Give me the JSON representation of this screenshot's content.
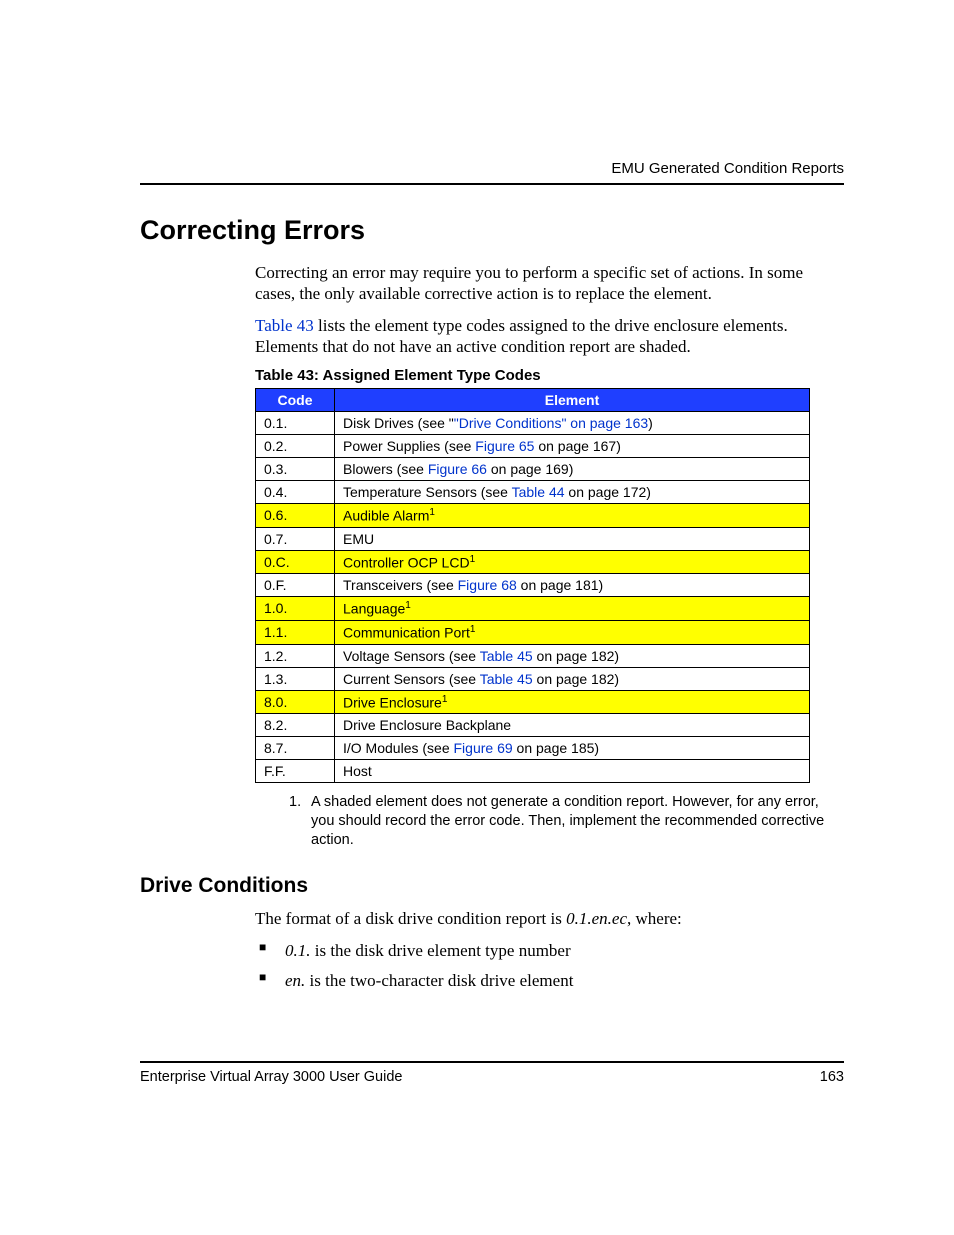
{
  "header": {
    "running_title": "EMU Generated Condition Reports"
  },
  "section1": {
    "title": "Correcting Errors",
    "para1": "Correcting an error may require you to perform a specific set of actions. In some cases, the only available corrective action is to replace the element.",
    "para2_link": "Table 43",
    "para2_rest": " lists the element type codes assigned to the drive enclosure elements. Elements that do not have an active condition report are shaded.",
    "table_caption": "Table 43:  Assigned Element Type Codes",
    "th_code": "Code",
    "th_element": "Element",
    "rows": [
      {
        "code": "0.1.",
        "pre": "Disk Drives (see \"",
        "link": "\"Drive Conditions\" on page 163",
        "post": ")",
        "shaded": false,
        "sup": ""
      },
      {
        "code": "0.2.",
        "pre": "Power Supplies (see ",
        "link": "Figure 65",
        "post": " on page 167)",
        "shaded": false,
        "sup": ""
      },
      {
        "code": "0.3.",
        "pre": "Blowers (see ",
        "link": "Figure 66",
        "post": " on page 169)",
        "shaded": false,
        "sup": ""
      },
      {
        "code": "0.4.",
        "pre": "Temperature Sensors (see ",
        "link": "Table 44",
        "post": " on page 172)",
        "shaded": false,
        "sup": ""
      },
      {
        "code": "0.6.",
        "pre": "Audible Alarm",
        "link": "",
        "post": "",
        "shaded": true,
        "sup": "1"
      },
      {
        "code": "0.7.",
        "pre": "EMU",
        "link": "",
        "post": "",
        "shaded": false,
        "sup": ""
      },
      {
        "code": "0.C.",
        "pre": "Controller OCP LCD",
        "link": "",
        "post": "",
        "shaded": true,
        "sup": "1"
      },
      {
        "code": "0.F.",
        "pre": "Transceivers (see ",
        "link": "Figure 68",
        "post": " on page 181)",
        "shaded": false,
        "sup": ""
      },
      {
        "code": "1.0.",
        "pre": "Language",
        "link": "",
        "post": "",
        "shaded": true,
        "sup": "1"
      },
      {
        "code": "1.1.",
        "pre": "Communication Port",
        "link": "",
        "post": "",
        "shaded": true,
        "sup": "1"
      },
      {
        "code": "1.2.",
        "pre": "Voltage Sensors (see ",
        "link": "Table 45",
        "post": " on page 182)",
        "shaded": false,
        "sup": ""
      },
      {
        "code": "1.3.",
        "pre": "Current Sensors (see ",
        "link": "Table 45",
        "post": " on page 182)",
        "shaded": false,
        "sup": ""
      },
      {
        "code": "8.0.",
        "pre": "Drive Enclosure",
        "link": "",
        "post": "",
        "shaded": true,
        "sup": "1"
      },
      {
        "code": "8.2.",
        "pre": "Drive Enclosure Backplane",
        "link": "",
        "post": "",
        "shaded": false,
        "sup": ""
      },
      {
        "code": "8.7.",
        "pre": "I/O Modules (see ",
        "link": "Figure 69",
        "post": " on page 185)",
        "shaded": false,
        "sup": ""
      },
      {
        "code": "F.F.",
        "pre": "Host",
        "link": "",
        "post": "",
        "shaded": false,
        "sup": ""
      }
    ],
    "footnote_num": "1.",
    "footnote_text": "A shaded element does not generate a condition report. However, for any error, you should record the error code. Then, implement the recommended corrective action."
  },
  "section2": {
    "title": "Drive Conditions",
    "para1_a": "The format of a disk drive condition report is ",
    "para1_i": "0.1.en.ec",
    "para1_b": ", where:",
    "bullet1_i": "0.1.",
    "bullet1_t": " is the disk drive element type number",
    "bullet2_i": "en.",
    "bullet2_t": " is the two-character disk drive element"
  },
  "footer": {
    "doc_title": "Enterprise Virtual Array 3000 User Guide",
    "page_num": "163"
  }
}
